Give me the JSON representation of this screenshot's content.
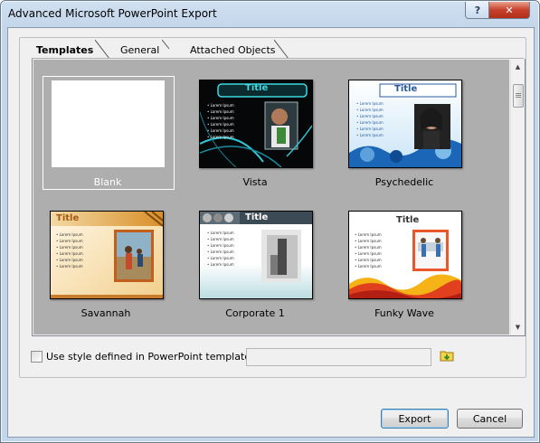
{
  "window": {
    "title": "Advanced Microsoft PowerPoint Export",
    "help": "?",
    "close": "✕"
  },
  "tabs": [
    {
      "label": "Templates",
      "active": true
    },
    {
      "label": "General",
      "active": false
    },
    {
      "label": "Attached Objects",
      "active": false
    }
  ],
  "templates": [
    {
      "name": "Blank",
      "selected": true
    },
    {
      "name": "Vista",
      "slide_title": "Title",
      "bullets": "• Lorem Ipsum\n• Lorem Ipsum\n• Lorem Ipsum\n• Lorem Ipsum\n• Lorem Ipsum\n• Lorem Ipsum"
    },
    {
      "name": "Psychedelic",
      "slide_title": "Title",
      "bullets": "• Lorem Ipsum\n• Lorem Ipsum\n• Lorem Ipsum\n• Lorem Ipsum\n• Lorem Ipsum\n• Lorem Ipsum"
    },
    {
      "name": "Savannah",
      "slide_title": "Title",
      "bullets": "• Lorem Ipsum\n• Lorem Ipsum\n• Lorem Ipsum\n• Lorem Ipsum\n• Lorem Ipsum\n• Lorem Ipsum"
    },
    {
      "name": "Corporate 1",
      "slide_title": "Title",
      "bullets": "• Lorem Ipsum\n• Lorem Ipsum\n• Lorem Ipsum\n• Lorem Ipsum\n• Lorem Ipsum\n• Lorem Ipsum"
    },
    {
      "name": "Funky Wave",
      "slide_title": "Title",
      "bullets": "• Lorem Ipsum\n• Lorem Ipsum\n• Lorem Ipsum\n• Lorem Ipsum\n• Lorem Ipsum\n• Lorem Ipsum"
    }
  ],
  "options": {
    "use_style_label": "Use style defined in PowerPoint template:",
    "use_style_checked": false,
    "template_path": ""
  },
  "buttons": {
    "export": "Export",
    "cancel": "Cancel"
  },
  "colors": {
    "gallery_bg": "#aeaeae",
    "vista_accent": "#3fd8e0",
    "psychedelic_title": "#2a5a9c",
    "savannah_title": "#a65a10"
  }
}
